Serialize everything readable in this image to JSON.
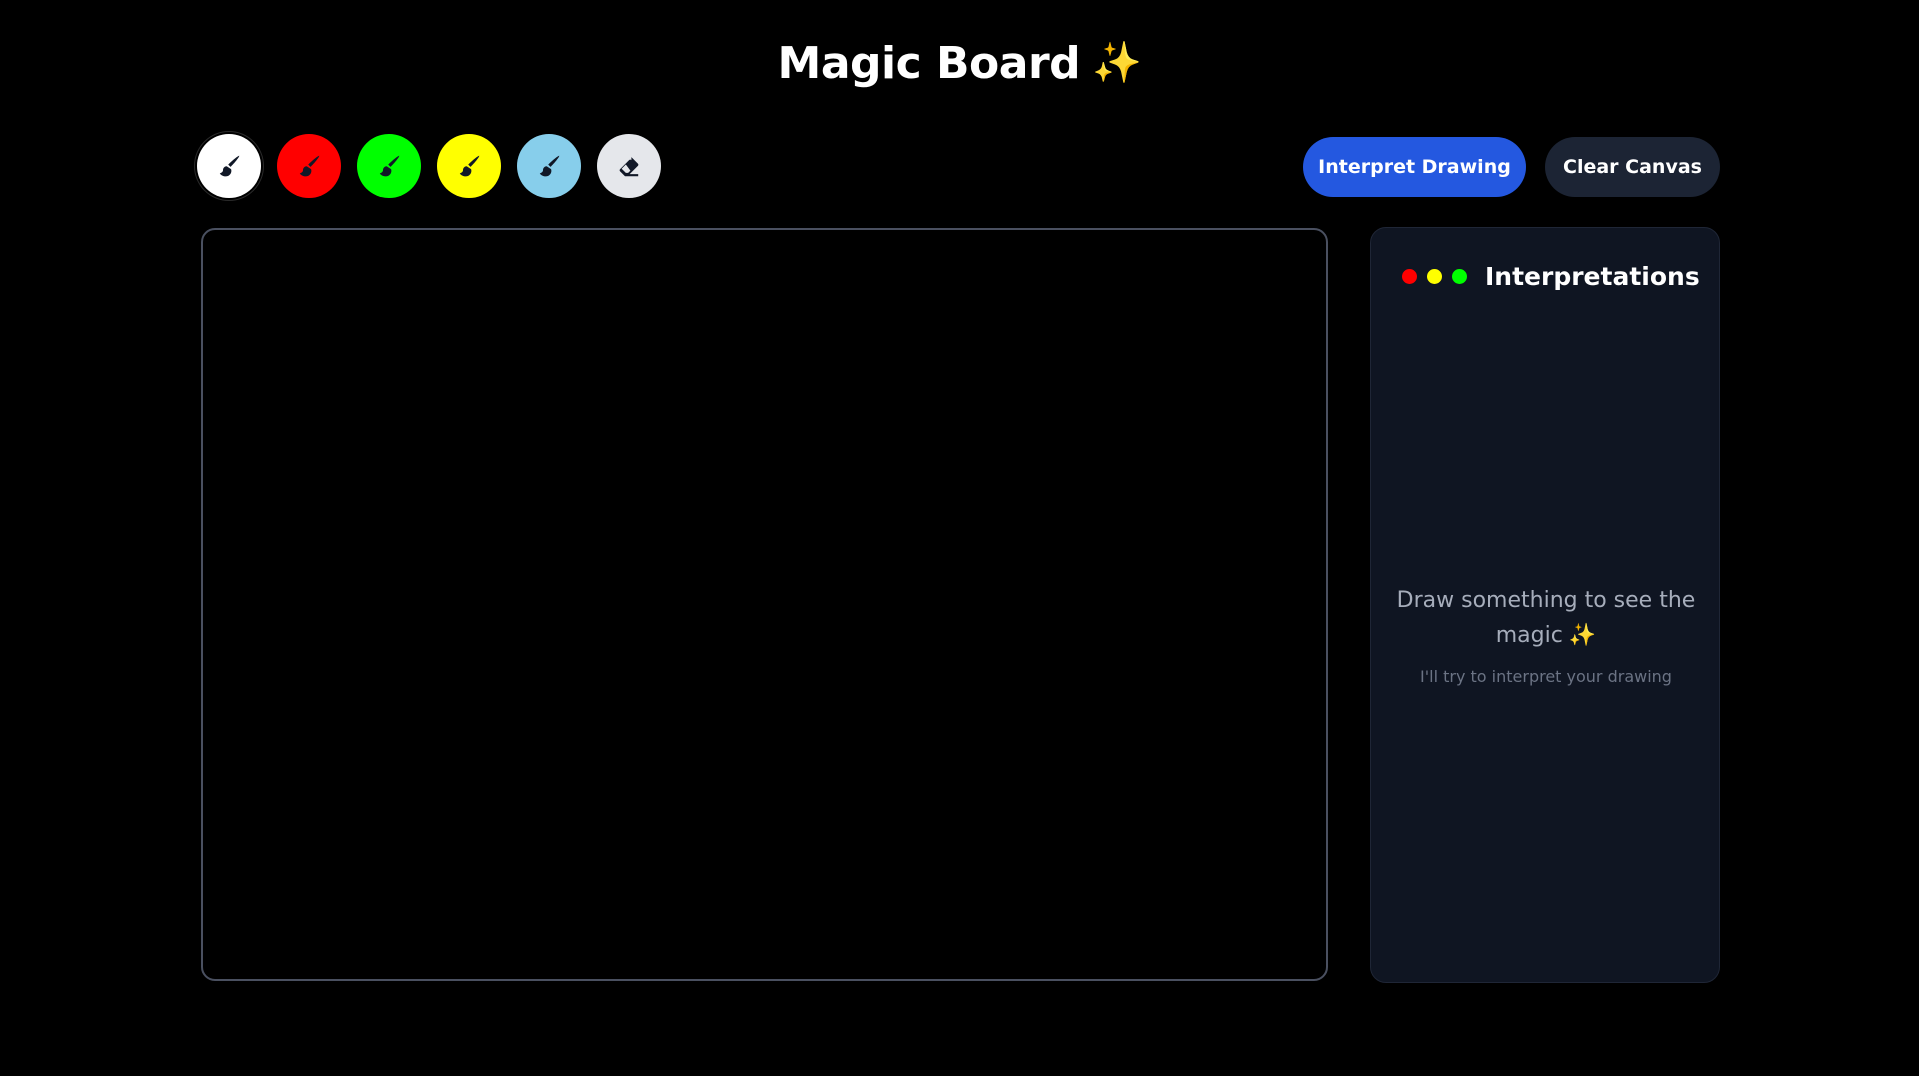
{
  "header": {
    "title": "Magic Board",
    "title_icon": "sparkles-icon",
    "title_icon_glyph": "✨"
  },
  "toolbar": {
    "tools": [
      {
        "name": "brush-white",
        "icon": "brush-icon",
        "color": "#ffffff"
      },
      {
        "name": "brush-red",
        "icon": "brush-icon",
        "color": "#ff0000"
      },
      {
        "name": "brush-green",
        "icon": "brush-icon",
        "color": "#00ff00"
      },
      {
        "name": "brush-yellow",
        "icon": "brush-icon",
        "color": "#ffff00"
      },
      {
        "name": "brush-light-blue",
        "icon": "brush-icon",
        "color": "#87ceeb"
      },
      {
        "name": "eraser",
        "icon": "eraser-icon",
        "color": "#e5e7eb"
      }
    ],
    "interpret_label": "Interpret Drawing",
    "clear_label": "Clear Canvas"
  },
  "panel": {
    "dots": [
      "#ff0000",
      "#ffff00",
      "#00ff00"
    ],
    "title": "Interpretations",
    "empty_main": "Draw something to see the magic",
    "empty_icon_glyph": "✨",
    "empty_sub": "I'll try to interpret your drawing"
  },
  "colors": {
    "accent": "#2458e0",
    "secondary_button": "#1c2434",
    "panel_bg": "#0f1522",
    "canvas_border": "#4a5060"
  }
}
